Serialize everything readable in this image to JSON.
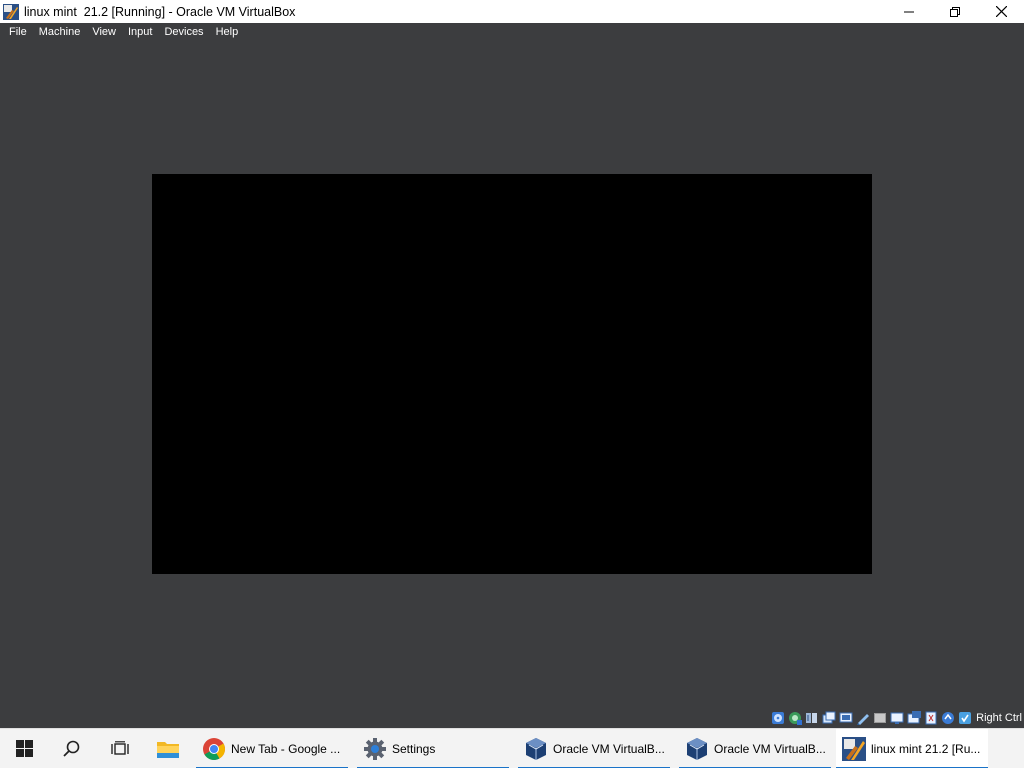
{
  "window": {
    "title": "linux mint  21.2 [Running] - Oracle VM VirtualBox",
    "controls": {
      "minimize": "—",
      "maximize": "❐",
      "close": "✕"
    }
  },
  "menu": [
    "File",
    "Machine",
    "View",
    "Input",
    "Devices",
    "Help"
  ],
  "vm": {
    "screen_color": "#000000",
    "background_color": "#3c3d3f"
  },
  "statusbar": {
    "icons": [
      "optical-drive-icon",
      "network-icon",
      "usb-icon",
      "shared-folders-icon",
      "display-icon",
      "recording-icon",
      "hard-disk-icon",
      "video-capture-icon",
      "mouse-integration-icon",
      "keyboard-icon",
      "cpu-icon",
      "host-key-icon"
    ],
    "host_key": "Right Ctrl"
  },
  "taskbar": {
    "apps": [
      {
        "label": "New Tab - Google ...",
        "icon": "chrome-icon",
        "running": true,
        "active": false
      },
      {
        "label": "Settings",
        "icon": "settings-gear-icon",
        "running": true,
        "active": false
      },
      {
        "label": "Oracle VM VirtualB...",
        "icon": "virtualbox-icon",
        "running": true,
        "active": false
      },
      {
        "label": "Oracle VM VirtualB...",
        "icon": "virtualbox-icon",
        "running": true,
        "active": false
      },
      {
        "label": "linux mint  21.2 [Ru...",
        "icon": "vm-window-icon",
        "running": true,
        "active": true
      }
    ]
  },
  "colors": {
    "accent": "#1a73c8",
    "taskbar": "#f3f3f3",
    "vm_chrome": "#3c3d3f"
  }
}
